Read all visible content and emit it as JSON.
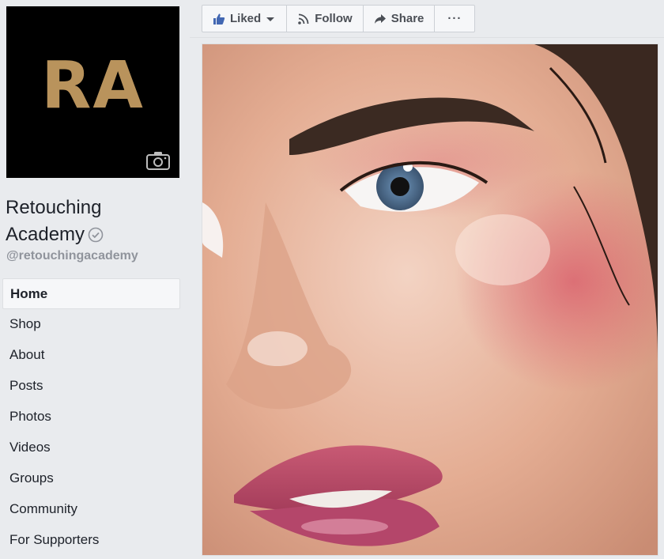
{
  "profile": {
    "logo_text": "RA",
    "name_line1": "Retouching",
    "name_line2": "Academy",
    "handle": "@retouchingacademy"
  },
  "nav": {
    "items": [
      {
        "label": "Home",
        "active": true
      },
      {
        "label": "Shop"
      },
      {
        "label": "About"
      },
      {
        "label": "Posts"
      },
      {
        "label": "Photos"
      },
      {
        "label": "Videos"
      },
      {
        "label": "Groups"
      },
      {
        "label": "Community"
      },
      {
        "label": "For Supporters"
      }
    ]
  },
  "toolbar": {
    "liked_label": "Liked",
    "follow_label": "Follow",
    "share_label": "Share",
    "more_label": "···"
  },
  "colors": {
    "logo_gold": "#b9935c",
    "facebook_blue": "#4267b2",
    "background": "#e9ebee"
  }
}
